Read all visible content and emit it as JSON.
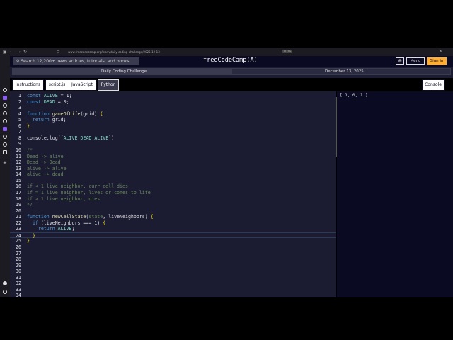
{
  "browser": {
    "url": "www.freecodecamp.org/learn/daily-coding-challenge/2025-12-13",
    "zoom": "110%"
  },
  "nav": {
    "search_placeholder": "Search 12,200+ news articles, tutorials, and books",
    "logo": "freeCodeCamp(🔥)",
    "logo_text": "freeCodeCamp(A)",
    "menu": "Menu",
    "signin": "Sign in"
  },
  "challenge": {
    "title": "Daily Coding Challenge",
    "date": "December 13, 2025"
  },
  "tabs": {
    "instructions": "Instructions",
    "file": "script.js",
    "javascript": "JavaScript",
    "python": "Python",
    "console": "Console"
  },
  "editor": {
    "lines": [
      [
        [
          "kw",
          "const "
        ],
        [
          "var",
          "ALIVE"
        ],
        [
          "pl",
          " = 1;"
        ]
      ],
      [
        [
          "kw",
          "const "
        ],
        [
          "var",
          "DEAD"
        ],
        [
          "pl",
          " = 0;"
        ]
      ],
      [],
      [
        [
          "kw",
          "function "
        ],
        [
          "fn",
          "gameOfLife"
        ],
        [
          "pl",
          "(grid) "
        ],
        [
          "br",
          "{"
        ]
      ],
      [
        [
          "kw",
          "  return "
        ],
        [
          "pl",
          "grid;"
        ]
      ],
      [
        [
          "br",
          "}"
        ]
      ],
      [],
      [
        [
          "pl",
          "console.log(["
        ],
        [
          "var",
          "ALIVE"
        ],
        [
          "pl",
          ","
        ],
        [
          "var",
          "DEAD"
        ],
        [
          "pl",
          ","
        ],
        [
          "var",
          "ALIVE"
        ],
        [
          "pl",
          "])"
        ]
      ],
      [],
      [
        [
          "cm",
          "/*"
        ]
      ],
      [
        [
          "cm",
          "Dead -> alive"
        ]
      ],
      [
        [
          "cm",
          "Dead -> Dead"
        ]
      ],
      [
        [
          "cm",
          "alive -> alive"
        ]
      ],
      [
        [
          "cm",
          "alive -> dead"
        ]
      ],
      [],
      [
        [
          "cm",
          "if < 1 live neighbor, curr cell dies"
        ]
      ],
      [
        [
          "cm",
          "if = 1 live neighbor, lives or comes to life"
        ]
      ],
      [
        [
          "cm",
          "if > 1 live neighbor, dies"
        ]
      ],
      [
        [
          "cm",
          "*/"
        ]
      ],
      [],
      [
        [
          "kw",
          "function "
        ],
        [
          "fn",
          "newCellState"
        ],
        [
          "pl",
          "("
        ],
        [
          "cm",
          "state"
        ],
        [
          "pl",
          ", liveNeighbors) "
        ],
        [
          "br",
          "{"
        ]
      ],
      [
        [
          "kw",
          "  if "
        ],
        [
          "pl",
          "(liveNeighbors === 1) "
        ],
        [
          "br",
          "{"
        ]
      ],
      [
        [
          "kw",
          "    return "
        ],
        [
          "var",
          "ALIVE"
        ],
        [
          "pl",
          ";"
        ]
      ],
      [
        [
          "br",
          "  }"
        ]
      ],
      [
        [
          "br",
          "}"
        ]
      ],
      [],
      [],
      [],
      [],
      [],
      [],
      [],
      [],
      []
    ]
  },
  "console": {
    "output": "[ 1, 0, 1 ]"
  }
}
